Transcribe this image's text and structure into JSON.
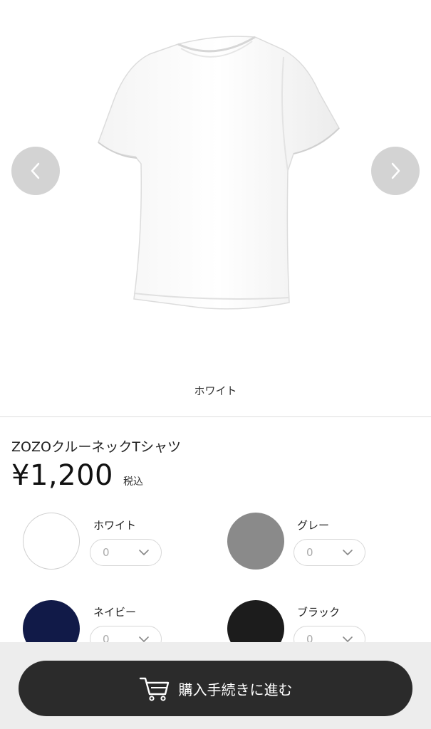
{
  "carousel": {
    "product_image": "white-crewneck-t-shirt",
    "prev_icon": "chevron-left-icon",
    "next_icon": "chevron-right-icon",
    "current_color_caption": "ホワイト"
  },
  "product": {
    "name": "ZOZOクルーネックTシャツ",
    "price": "¥1,200",
    "tax_label": "税込"
  },
  "colors": [
    {
      "name": "ホワイト",
      "swatch_color": "#ffffff",
      "quantity": "0"
    },
    {
      "name": "グレー",
      "swatch_color": "#8a8a8a",
      "quantity": "0"
    },
    {
      "name": "ネイビー",
      "swatch_color": "#111a48",
      "quantity": "0"
    },
    {
      "name": "ブラック",
      "swatch_color": "#1c1c1c",
      "quantity": "0"
    }
  ],
  "checkout": {
    "label": "購入手続きに進む",
    "icon": "cart-icon",
    "button_color": "#2b2b2b"
  }
}
